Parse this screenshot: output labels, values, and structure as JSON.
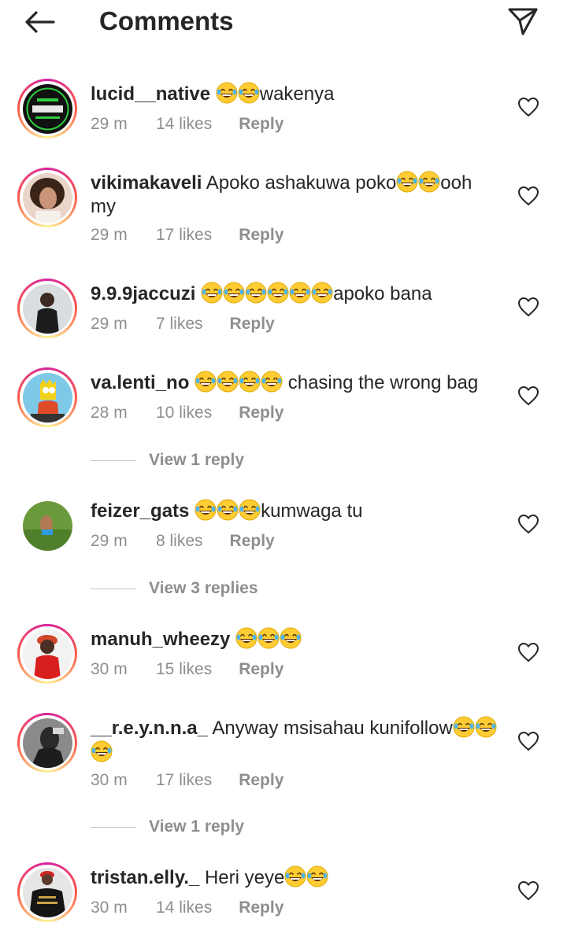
{
  "header": {
    "title": "Comments",
    "back_icon": "back-arrow-icon",
    "share_icon": "paper-plane-icon"
  },
  "colors": {
    "text": "#262626",
    "secondary": "#8e8e8e",
    "story_ring_start": "#d6249f",
    "story_ring_end": "#fd5949"
  },
  "comments": [
    {
      "username": "lucid__native",
      "before": " ",
      "laugh_count": 2,
      "after": "wakenya",
      "time": "29 m",
      "likes": "14 likes",
      "reply": "Reply",
      "ring": true
    },
    {
      "username": "vikimakaveli",
      "before": " Apoko ashakuwa poko",
      "laugh_count": 2,
      "after": "ooh my",
      "time": "29 m",
      "likes": "17 likes",
      "reply": "Reply",
      "ring": true
    },
    {
      "username": "9.9.9jaccuzi",
      "before": " ",
      "laugh_count": 6,
      "after": "apoko bana",
      "time": "29 m",
      "likes": "7 likes",
      "reply": "Reply",
      "ring": true
    },
    {
      "username": "va.lenti_no",
      "before": " ",
      "laugh_count": 4,
      "after": " chasing the wrong bag",
      "time": "28 m",
      "likes": "10 likes",
      "reply": "Reply",
      "ring": true,
      "view_replies": "View 1 reply"
    },
    {
      "username": "feizer_gats",
      "before": " ",
      "laugh_count": 3,
      "after": "kumwaga tu",
      "time": "29 m",
      "likes": "8 likes",
      "reply": "Reply",
      "ring": false,
      "view_replies": "View 3 replies"
    },
    {
      "username": "manuh_wheezy",
      "before": " ",
      "laugh_count": 3,
      "after": "",
      "time": "30 m",
      "likes": "15 likes",
      "reply": "Reply",
      "ring": true
    },
    {
      "username": "__r.e.y.n.n.a_",
      "before": " Anyway msisahau kunifollow",
      "laugh_count": 3,
      "after": "",
      "time": "30 m",
      "likes": "17 likes",
      "reply": "Reply",
      "ring": true,
      "view_replies": "View 1 reply"
    },
    {
      "username": "tristan.elly._",
      "before": " Heri yeye",
      "laugh_count": 2,
      "after": "",
      "time": "30 m",
      "likes": "14 likes",
      "reply": "Reply",
      "ring": true
    }
  ]
}
